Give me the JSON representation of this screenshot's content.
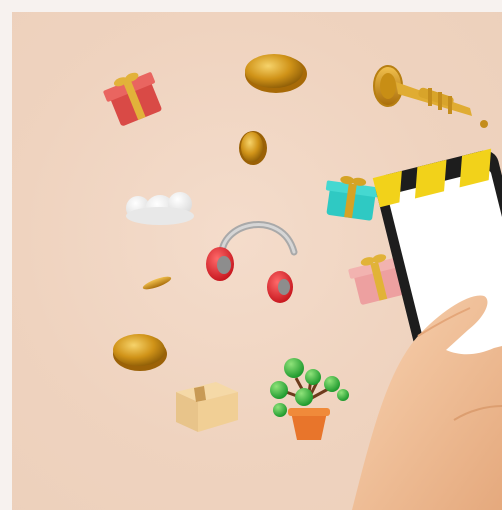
{
  "image": {
    "kind": "3d-illustration",
    "background_color": "#efd3bf",
    "objects": [
      "gift-box",
      "gold-coin",
      "trumpet",
      "cloud",
      "headphones",
      "gift-box-teal",
      "gift-box-pink",
      "cardboard-box",
      "potted-plant",
      "smartphone",
      "hand"
    ]
  }
}
